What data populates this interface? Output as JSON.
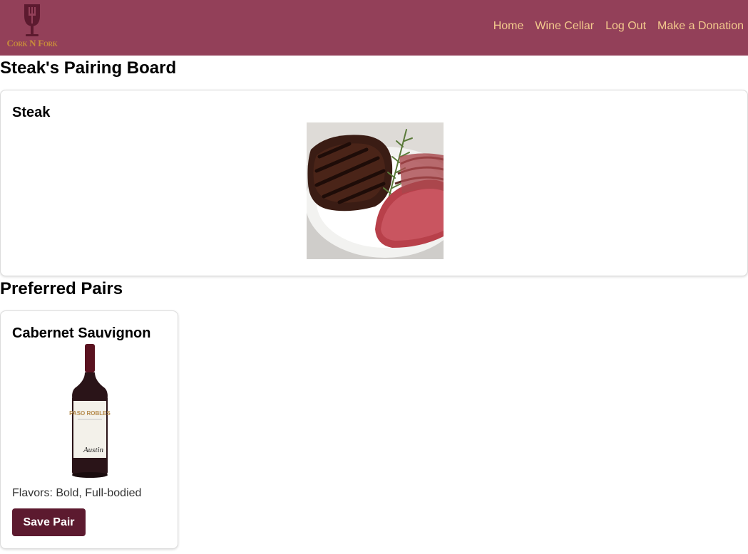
{
  "brand": {
    "logo_text": "Cork N Fork",
    "colors": {
      "navbar": "#934059",
      "nav_link": "#f3c98d",
      "logo_text": "#c98d3a",
      "button": "#5c1a2f"
    }
  },
  "nav": {
    "links": [
      {
        "label": "Home"
      },
      {
        "label": "Wine Cellar"
      },
      {
        "label": "Log Out"
      },
      {
        "label": "Make a Donation"
      }
    ]
  },
  "page": {
    "title": "Steak's Pairing Board"
  },
  "food": {
    "name": "Steak",
    "image_icon": "steak-image"
  },
  "pairs": {
    "title": "Preferred Pairs",
    "items": [
      {
        "name": "Cabernet Sauvignon",
        "image_icon": "wine-bottle-image",
        "label_line1": "PASO ROBLES",
        "label_signature": "Austin",
        "flavors": "Flavors: Bold, Full-bodied",
        "save_label": "Save Pair"
      }
    ]
  }
}
